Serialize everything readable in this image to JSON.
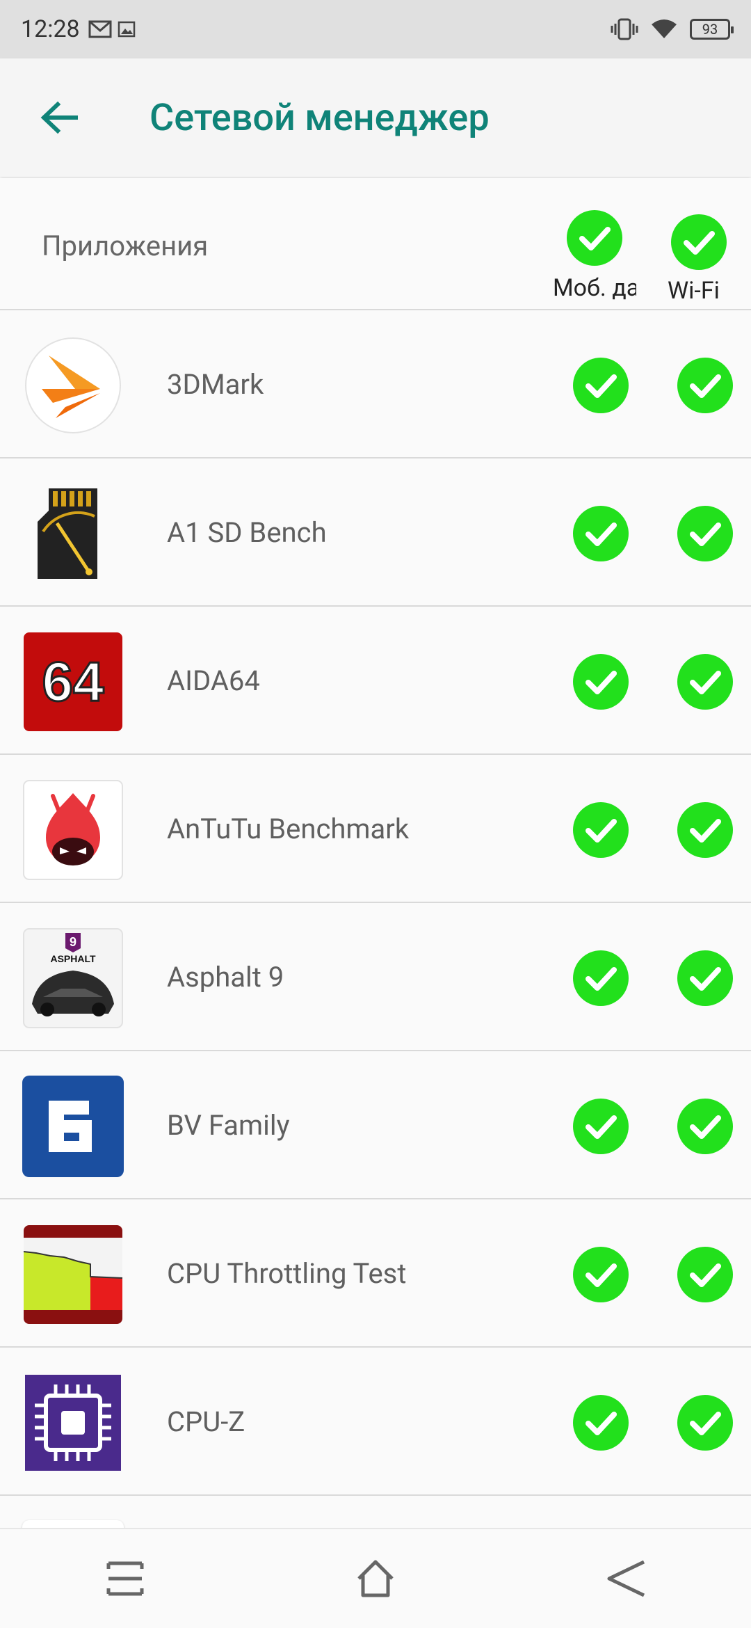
{
  "status": {
    "time": "12:28",
    "battery": "93"
  },
  "app_bar": {
    "title": "Сетевой менеджер"
  },
  "header": {
    "label": "Приложения",
    "mobile_caption": "Моб. данные",
    "wifi_caption": "Wi-Fi"
  },
  "apps": [
    {
      "name": "3DMark",
      "icon": "3dmark-icon"
    },
    {
      "name": "A1 SD Bench",
      "icon": "sd-bench-icon"
    },
    {
      "name": "AIDA64",
      "icon": "aida64-icon"
    },
    {
      "name": "AnTuTu Benchmark",
      "icon": "antutu-icon"
    },
    {
      "name": "Asphalt 9",
      "icon": "asphalt-icon"
    },
    {
      "name": "BV Family",
      "icon": "bv-family-icon"
    },
    {
      "name": "CPU Throttling Test",
      "icon": "cpu-throttling-icon"
    },
    {
      "name": "CPU-Z",
      "icon": "cpu-z-icon"
    }
  ],
  "colors": {
    "accent": "#0f8378",
    "toggle_on": "#22e01c"
  }
}
